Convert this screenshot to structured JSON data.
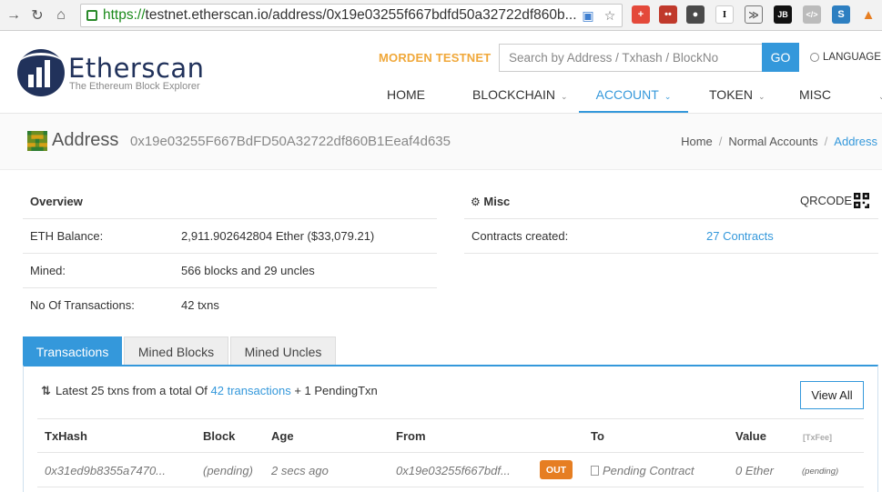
{
  "browser": {
    "url_scheme": "https://",
    "url_rest": "testnet.etherscan.io/address/0x19e03255f667bdfd50a32722df860b..."
  },
  "header": {
    "logo_word": "Etherscan",
    "logo_sub": "The Ethereum Block Explorer",
    "network": "MORDEN TESTNET",
    "search_placeholder": "Search by Address / Txhash / BlockNo",
    "go_label": "GO",
    "language_label": "LANGUAGE",
    "nav": [
      "HOME",
      "BLOCKCHAIN",
      "ACCOUNT",
      "TOKEN",
      "MISC"
    ]
  },
  "address": {
    "title": "Address",
    "hash": "0x19e03255F667BdFD50A32722df860B1Eeaf4d635",
    "breadcrumb": [
      "Home",
      "Normal Accounts",
      "Address"
    ]
  },
  "overview": {
    "heading": "Overview",
    "rows": [
      {
        "label": "ETH Balance:",
        "value": "2,911.902642804 Ether ($33,079.21)"
      },
      {
        "label": "Mined:",
        "value": "566 blocks and 29 uncles"
      },
      {
        "label": "No Of Transactions:",
        "value": "42 txns"
      }
    ]
  },
  "misc": {
    "heading": "Misc",
    "qrcode_label": "QRCODE",
    "contracts_label": "Contracts created:",
    "contracts_value": "27 Contracts"
  },
  "tabs": [
    "Transactions",
    "Mined Blocks",
    "Mined Uncles"
  ],
  "transactions": {
    "summary_pre": "Latest 25 txns from a total Of",
    "summary_link": "42 transactions",
    "summary_post": "+ 1 PendingTxn",
    "view_all": "View All",
    "columns": [
      "TxHash",
      "Block",
      "Age",
      "From",
      "To",
      "Value",
      "[TxFee]"
    ],
    "rows": [
      {
        "txhash": "0x31ed9b8355a7470...",
        "block": "(pending)",
        "age": "2 secs ago",
        "from": "0x19e03255f667bdf...",
        "direction": "OUT",
        "to": "Pending Contract",
        "value": "0 Ether",
        "fee": "(pending)"
      }
    ]
  },
  "colors": {
    "accent": "#3498db",
    "network": "#f0a83a",
    "out_badge": "#e67e22",
    "logo": "#21325b"
  }
}
